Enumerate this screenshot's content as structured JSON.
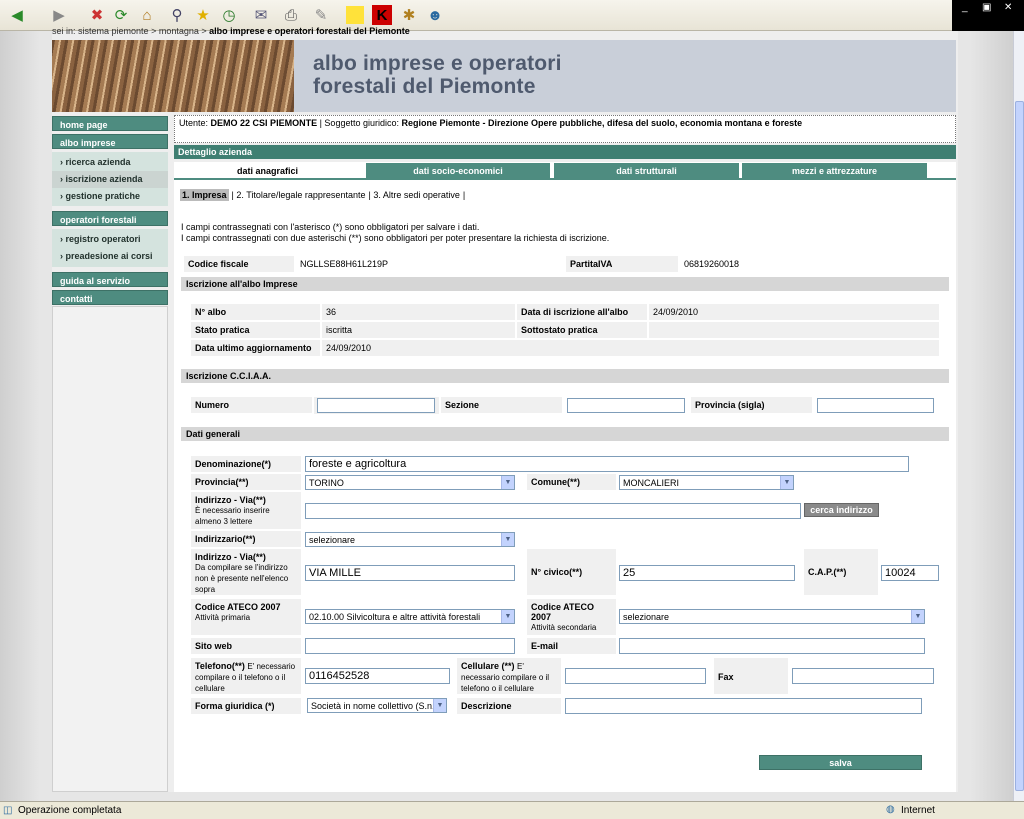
{
  "browser": {
    "toolbar_icons": [
      "back-icon",
      "forward-icon",
      "stop-icon",
      "refresh-icon",
      "home-icon",
      "search-icon",
      "favorites-icon",
      "history-icon",
      "mail-icon",
      "print-icon",
      "edit-icon",
      "notes-icon",
      "kaspersky-icon",
      "bookmark-icon",
      "messenger-icon"
    ]
  },
  "breadcrumb": {
    "prefix": "sei in:",
    "part1": "sistema piemonte",
    "part2": "montagna",
    "current": "albo imprese e operatori forestali del Piemonte"
  },
  "banner": {
    "title_line1": "albo imprese e operatori",
    "title_line2": "forestali del Piemonte"
  },
  "nav": {
    "home": "home page",
    "albo": "albo imprese",
    "albo_items": [
      "ricerca azienda",
      "iscrizione azienda",
      "gestione pratiche"
    ],
    "operatori": "operatori forestali",
    "operatori_items": [
      "registro operatori",
      "preadesione ai corsi"
    ],
    "guida": "guida al servizio",
    "contatti": "contatti"
  },
  "user": {
    "label": "Utente:",
    "name": "DEMO 22 CSI PIEMONTE",
    "soggetto_label": "| Soggetto giuridico:",
    "soggetto": "Regione Piemonte - Direzione Opere pubbliche, difesa del suolo, economia montana e foreste"
  },
  "section_title": "Dettaglio azienda",
  "tabs": [
    "dati anagrafici",
    "dati socio-economici",
    "dati strutturali",
    "mezzi e attrezzature"
  ],
  "subtabs": [
    "1. Impresa",
    "2. Titolare/legale rappresentante",
    "3. Altre sedi operative"
  ],
  "notes": [
    "I campi contrassegnati con l'asterisco (*) sono obbligatori per salvare i dati.",
    "I campi contrassegnati con due asterischi (**) sono obbligatori per poter presentare la richiesta di iscrizione."
  ],
  "codice_fiscale": {
    "label": "Codice fiscale",
    "value": "NGLLSE88H61L219P"
  },
  "partita_iva": {
    "label": "PartitaIVA",
    "value": "06819260018"
  },
  "iscrizione_albo": {
    "header": "Iscrizione all'albo Imprese",
    "n_albo_label": "N° albo",
    "n_albo": "36",
    "data_iscr_label": "Data di iscrizione all'albo",
    "data_iscr": "24/09/2010",
    "stato_label": "Stato pratica",
    "stato": "iscritta",
    "sottostato_label": "Sottostato pratica",
    "sottostato": "",
    "data_agg_label": "Data ultimo aggiornamento",
    "data_agg": "24/09/2010"
  },
  "cciaa": {
    "header": "Iscrizione C.C.I.A.A.",
    "numero_label": "Numero",
    "numero": "",
    "sezione_label": "Sezione",
    "sezione": "",
    "provincia_label": "Provincia (sigla)",
    "provincia": ""
  },
  "dati_generali": {
    "header": "Dati generali",
    "denominazione_label": "Denominazione(*)",
    "denominazione": "foreste e agricoltura",
    "provincia_label": "Provincia(**)",
    "provincia": "TORINO",
    "comune_label": "Comune(**)",
    "comune": "MONCALIERI",
    "indirizzo_label": "Indirizzo - Via(**)",
    "indirizzo_note": "È necessario inserire almeno 3 lettere",
    "indirizzo": "",
    "cerca_button": "cerca indirizzo",
    "indirizzario_label": "Indirizzario(**)",
    "indirizzario": "selezionare",
    "indirizzo2_label": "Indirizzo - Via(**)",
    "indirizzo2_note": "Da compilare se l'indirizzo non è presente nell'elenco sopra",
    "indirizzo2": "VIA MILLE",
    "civico_label": "N° civico(**)",
    "civico": "25",
    "cap_label": "C.A.P.(**)",
    "cap": "10024",
    "ateco1_label": "Codice ATECO 2007",
    "ateco1_note": "Attività primaria",
    "ateco1": "02.10.00 Silvicoltura e altre attività forestali",
    "ateco2_label": "Codice ATECO 2007",
    "ateco2_note": "Attività secondaria",
    "ateco2": "selezionare",
    "sito_label": "Sito web",
    "sito": "",
    "email_label": "E-mail",
    "email": "",
    "telefono_label": "Telefono(**)",
    "telefono_note": "E' necessario compilare o il telefono o il cellulare",
    "telefono": "0116452528",
    "cellulare_label": "Cellulare (**)",
    "cellulare_note": "E' necessario compilare o il telefono o il cellulare",
    "cellulare": "",
    "fax_label": "Fax",
    "fax": "",
    "forma_label": "Forma giuridica (*)",
    "forma": "Società in nome collettivo (S.n.c.)",
    "descrizione_label": "Descrizione",
    "descrizione": ""
  },
  "salva_button": "salva",
  "status": {
    "text": "Operazione completata",
    "zone": "Internet"
  }
}
